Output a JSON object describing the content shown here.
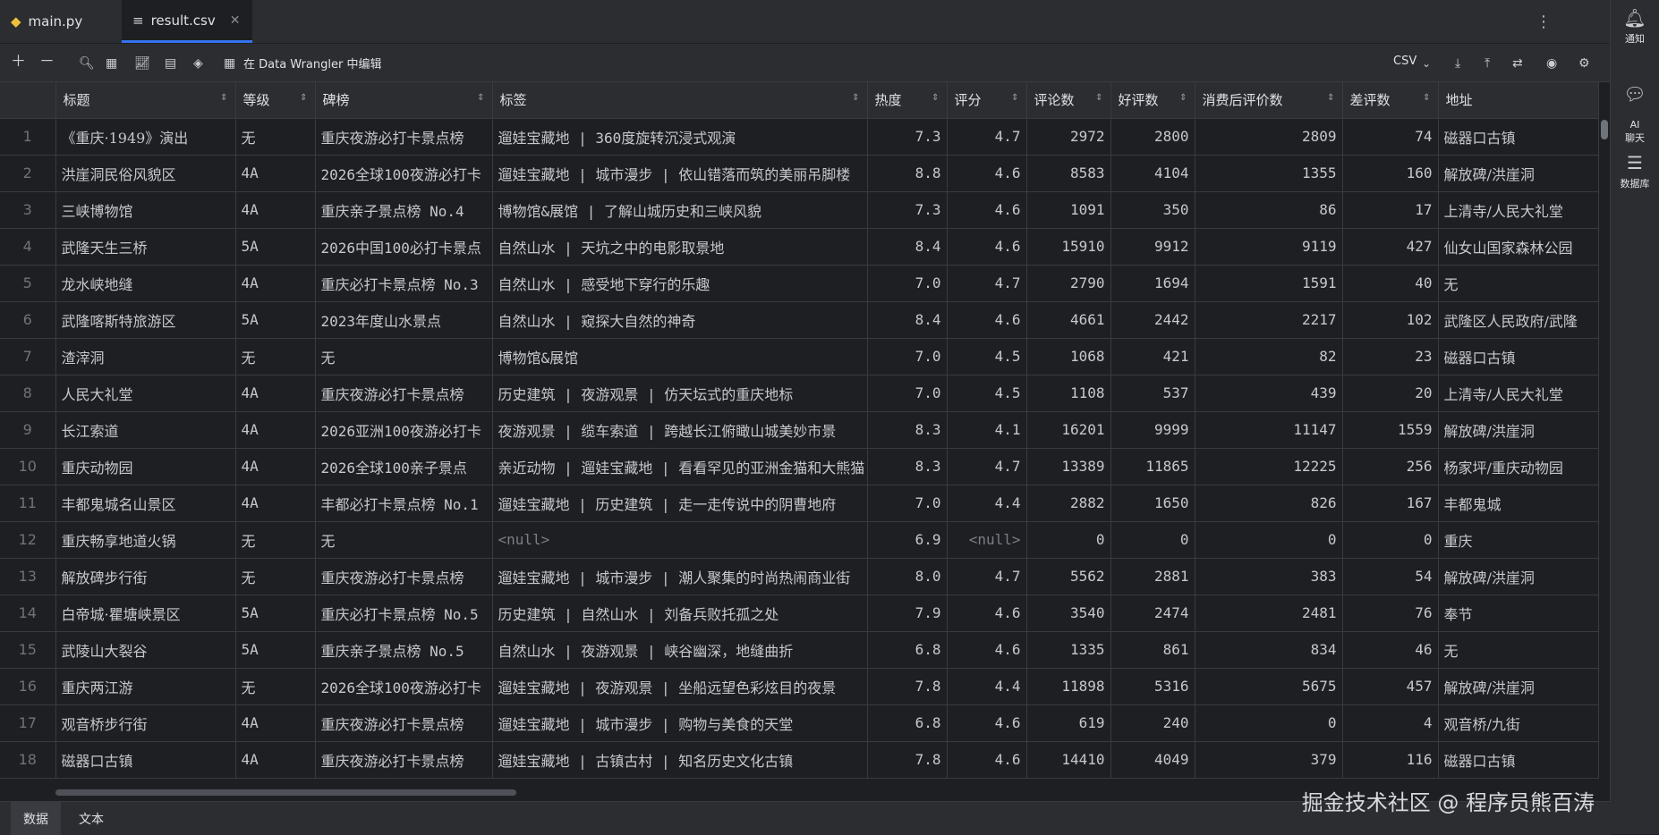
{
  "tabs": [
    {
      "label": "main.py",
      "icon": "python-icon"
    },
    {
      "label": "result.csv",
      "icon": "csv-file-icon",
      "close": "✕"
    }
  ],
  "toolbar": {
    "data_wrangler_label": "在 Data Wrangler 中编辑",
    "format_label": "CSV"
  },
  "sidebar": {
    "items": [
      {
        "label": "通知",
        "icon": "bell-icon"
      },
      {
        "label": "AI\n聊天",
        "icon": "ai-chat-icon"
      },
      {
        "label": "数据库",
        "icon": "database-icon"
      }
    ]
  },
  "table": {
    "columns": [
      "标题",
      "等级",
      "碑榜",
      "标签",
      "热度",
      "评分",
      "评论数",
      "好评数",
      "消费后评价数",
      "差评数",
      "地址"
    ],
    "rows": [
      [
        "1",
        "《重庆·1949》演出",
        "无",
        "重庆夜游必打卡景点榜",
        "遛娃宝藏地 | 360度旋转沉浸式观演",
        "7.3",
        "4.7",
        "2972",
        "2800",
        "2809",
        "74",
        "磁器口古镇"
      ],
      [
        "2",
        "洪崖洞民俗风貌区",
        "4A",
        "2026全球100夜游必打卡",
        "遛娃宝藏地 | 城市漫步 | 依山错落而筑的美丽吊脚楼",
        "8.8",
        "4.6",
        "8583",
        "4104",
        "1355",
        "160",
        "解放碑/洪崖洞"
      ],
      [
        "3",
        "三峡博物馆",
        "4A",
        "重庆亲子景点榜 No.4",
        "博物馆&展馆 | 了解山城历史和三峡风貌",
        "7.3",
        "4.6",
        "1091",
        "350",
        "86",
        "17",
        "上清寺/人民大礼堂"
      ],
      [
        "4",
        "武隆天生三桥",
        "5A",
        "2026中国100必打卡景点",
        "自然山水 | 天坑之中的电影取景地",
        "8.4",
        "4.6",
        "15910",
        "9912",
        "9119",
        "427",
        "仙女山国家森林公园"
      ],
      [
        "5",
        "龙水峡地缝",
        "4A",
        "重庆必打卡景点榜 No.3",
        "自然山水 | 感受地下穿行的乐趣",
        "7.0",
        "4.7",
        "2790",
        "1694",
        "1591",
        "40",
        "无"
      ],
      [
        "6",
        "武隆喀斯特旅游区",
        "5A",
        "2023年度山水景点",
        "自然山水 | 窥探大自然的神奇",
        "8.4",
        "4.6",
        "4661",
        "2442",
        "2217",
        "102",
        "武隆区人民政府/武隆"
      ],
      [
        "7",
        "渣滓洞",
        "无",
        "无",
        "博物馆&展馆",
        "7.0",
        "4.5",
        "1068",
        "421",
        "82",
        "23",
        "磁器口古镇"
      ],
      [
        "8",
        "人民大礼堂",
        "4A",
        "重庆夜游必打卡景点榜",
        "历史建筑 | 夜游观景 | 仿天坛式的重庆地标",
        "7.0",
        "4.5",
        "1108",
        "537",
        "439",
        "20",
        "上清寺/人民大礼堂"
      ],
      [
        "9",
        "长江索道",
        "4A",
        "2026亚洲100夜游必打卡",
        "夜游观景 | 缆车索道 | 跨越长江俯瞰山城美妙市景",
        "8.3",
        "4.1",
        "16201",
        "9999",
        "11147",
        "1559",
        "解放碑/洪崖洞"
      ],
      [
        "10",
        "重庆动物园",
        "4A",
        "2026全球100亲子景点",
        "亲近动物 | 遛娃宝藏地 | 看看罕见的亚洲金猫和大熊猫",
        "8.3",
        "4.7",
        "13389",
        "11865",
        "12225",
        "256",
        "杨家坪/重庆动物园"
      ],
      [
        "11",
        "丰都鬼城名山景区",
        "4A",
        "丰都必打卡景点榜 No.1",
        "遛娃宝藏地 | 历史建筑 | 走一走传说中的阴曹地府",
        "7.0",
        "4.4",
        "2882",
        "1650",
        "826",
        "167",
        "丰都鬼城"
      ],
      [
        "12",
        "重庆畅享地道火锅",
        "无",
        "无",
        "<null>",
        "6.9",
        "<null>",
        "0",
        "0",
        "0",
        "0",
        "重庆"
      ],
      [
        "13",
        "解放碑步行街",
        "无",
        "重庆夜游必打卡景点榜",
        "遛娃宝藏地 | 城市漫步 | 潮人聚集的时尚热闹商业街",
        "8.0",
        "4.7",
        "5562",
        "2881",
        "383",
        "54",
        "解放碑/洪崖洞"
      ],
      [
        "14",
        "白帝城·瞿塘峡景区",
        "5A",
        "重庆必打卡景点榜 No.5",
        "历史建筑 | 自然山水 | 刘备兵败托孤之处",
        "7.9",
        "4.6",
        "3540",
        "2474",
        "2481",
        "76",
        "奉节"
      ],
      [
        "15",
        "武陵山大裂谷",
        "5A",
        "重庆亲子景点榜 No.5",
        "自然山水 | 夜游观景 | 峡谷幽深，地缝曲折",
        "6.8",
        "4.6",
        "1335",
        "861",
        "834",
        "46",
        "无"
      ],
      [
        "16",
        "重庆两江游",
        "无",
        "2026全球100夜游必打卡",
        "遛娃宝藏地 | 夜游观景 | 坐船远望色彩炫目的夜景",
        "7.8",
        "4.4",
        "11898",
        "5316",
        "5675",
        "457",
        "解放碑/洪崖洞"
      ],
      [
        "17",
        "观音桥步行街",
        "4A",
        "重庆夜游必打卡景点榜",
        "遛娃宝藏地 | 城市漫步 | 购物与美食的天堂",
        "6.8",
        "4.6",
        "619",
        "240",
        "0",
        "4",
        "观音桥/九街"
      ],
      [
        "18",
        "磁器口古镇",
        "4A",
        "重庆夜游必打卡景点榜",
        "遛娃宝藏地 | 古镇古村 | 知名历史文化古镇",
        "7.8",
        "4.6",
        "14410",
        "4049",
        "379",
        "116",
        "磁器口古镇"
      ]
    ]
  },
  "bottom_tabs": [
    "数据",
    "文本"
  ],
  "watermark": "掘金技术社区 @ 程序员熊百涛"
}
